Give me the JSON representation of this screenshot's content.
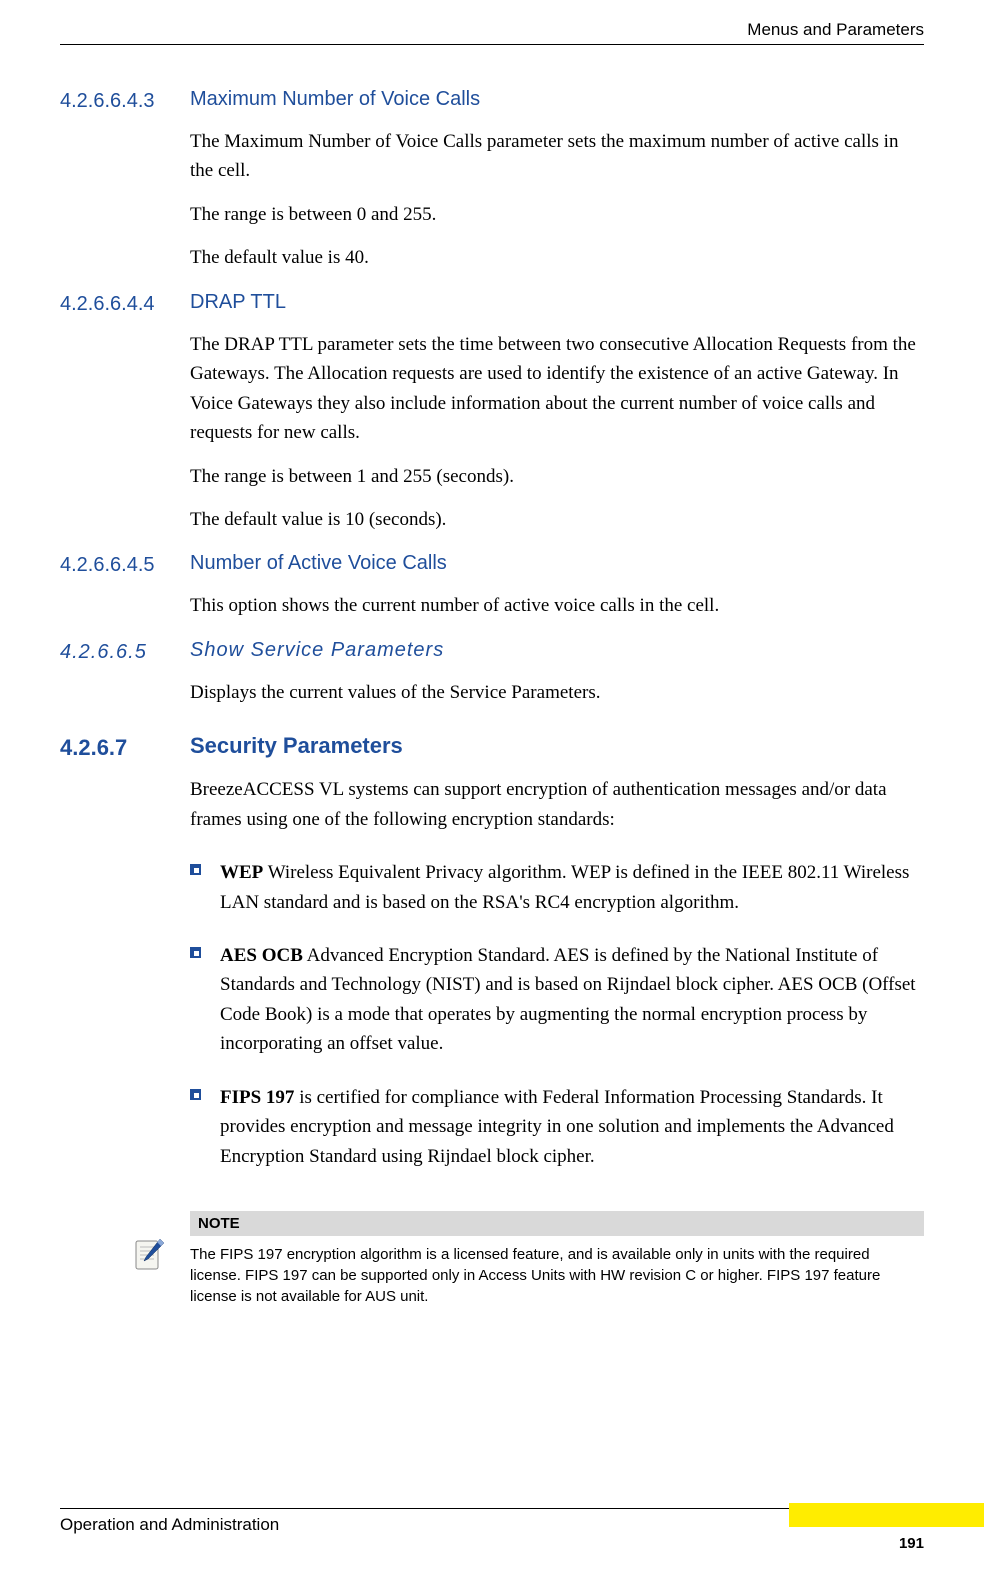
{
  "header": {
    "right": "Menus and Parameters"
  },
  "sections": [
    {
      "num": "4.2.6.6.4.3",
      "title": "Maximum Number of Voice Calls",
      "paras": [
        "The Maximum Number of Voice Calls parameter sets the maximum number of active calls in the cell.",
        "The range is between 0 and 255.",
        "The default value is 40."
      ]
    },
    {
      "num": "4.2.6.6.4.4",
      "title": "DRAP TTL",
      "paras": [
        "The DRAP TTL parameter sets the time between two consecutive Allocation Requests from the Gateways. The Allocation requests are used to identify the existence of an active Gateway. In Voice Gateways they also include information about the current number of voice calls and requests for new calls.",
        "The range is between 1 and 255 (seconds).",
        "The default value is 10 (seconds)."
      ]
    },
    {
      "num": "4.2.6.6.4.5",
      "title": "Number of Active Voice Calls",
      "paras": [
        "This option shows the current number of active voice calls in the cell."
      ]
    }
  ],
  "midSection": {
    "num": "4.2.6.6.5",
    "title": "Show Service Parameters",
    "para": "Displays the current values of the Service Parameters."
  },
  "bigSection": {
    "num": "4.2.6.7",
    "title": "Security Parameters",
    "intro": "BreezeACCESS VL systems can support encryption of authentication messages and/or data frames using one of the following encryption standards:",
    "bullets": [
      {
        "bold": "WEP",
        "rest": " Wireless Equivalent Privacy algorithm. WEP is defined in the IEEE 802.11 Wireless LAN standard and is based on the RSA's RC4 encryption algorithm."
      },
      {
        "bold": "AES OCB",
        "rest": " Advanced Encryption Standard. AES is defined by the National Institute of Standards and Technology (NIST) and is based on Rijndael block cipher. AES OCB (Offset Code Book) is a mode that operates by augmenting the normal encryption process by incorporating an offset value."
      },
      {
        "bold": "FIPS 197",
        "rest": " is certified for compliance with Federal Information Processing Standards. It provides encryption and message integrity in one solution and implements the Advanced Encryption Standard using Rijndael block cipher."
      }
    ]
  },
  "note": {
    "label": "NOTE",
    "body": "The FIPS 197 encryption algorithm is a licensed feature, and is available only in units with the required license. FIPS 197 can be supported only in Access Units with HW revision C or higher. FIPS 197 feature license is not available for AUS unit."
  },
  "footer": {
    "left": "Operation and Administration",
    "page": "191"
  }
}
